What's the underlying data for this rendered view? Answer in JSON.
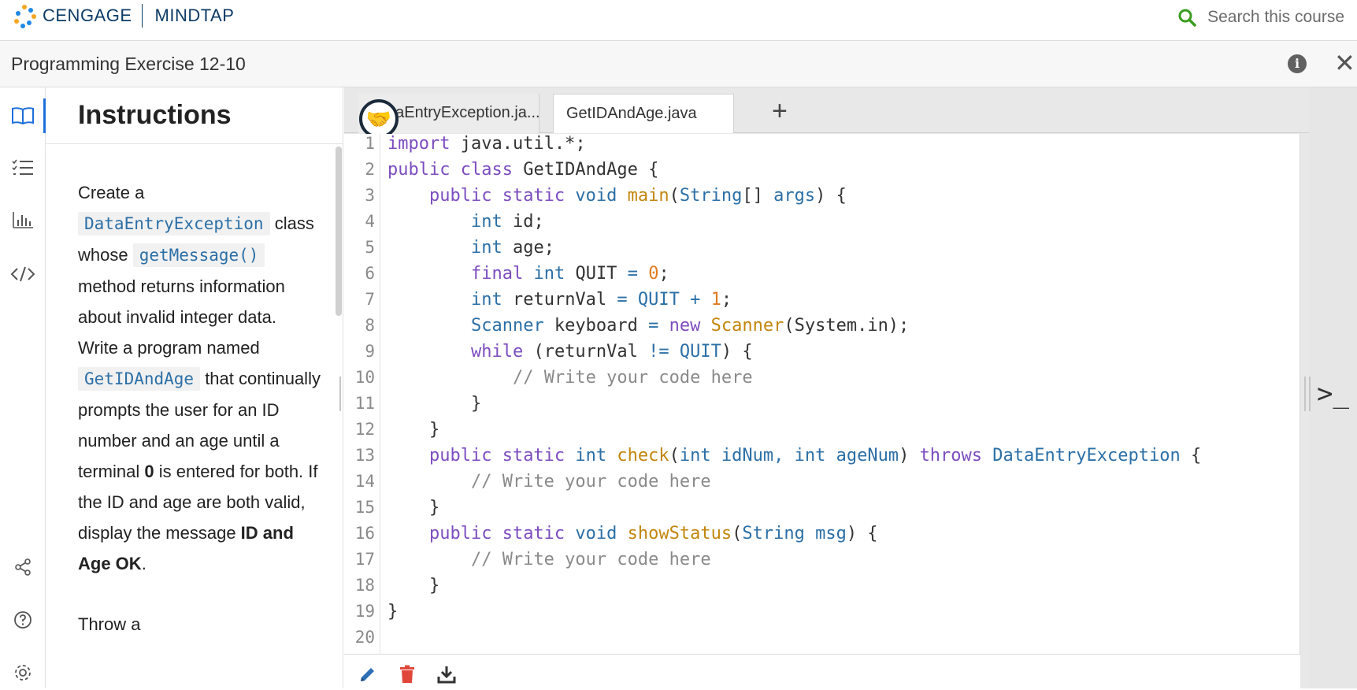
{
  "header": {
    "brand": "CENGAGE",
    "product": "MINDTAP",
    "search_placeholder": "Search this course"
  },
  "titlebar": {
    "title": "Programming Exercise 12-10"
  },
  "rail": {
    "icons": [
      "book-icon",
      "checklist-icon",
      "chart-icon",
      "code-icon",
      "share-icon",
      "help-icon",
      "settings-icon"
    ]
  },
  "instructions": {
    "title": "Instructions",
    "p1": {
      "t1": "Create a ",
      "c1": "DataEntryException",
      "t2": " class whose ",
      "c2": "getMessage()",
      "t3": " method returns information about invalid integer data. Write a program named ",
      "c3": "GetIDAndAge",
      "t4": " that continually prompts the user for an ID number and an age until a terminal ",
      "b1": "0",
      "t5": " is entered for both. If the ID and age are both valid, display the message ",
      "b2": "ID and Age OK",
      "t6": "."
    },
    "p2": "Throw a"
  },
  "editor": {
    "tabs": [
      {
        "label": "DataEntryException.ja..."
      },
      {
        "label": "GetIDAndAge.java"
      }
    ],
    "add_tab_label": "+",
    "collab_icon": "handshake-icon",
    "line_numbers": [
      "1",
      "2",
      "3",
      "4",
      "5",
      "6",
      "7",
      "8",
      "9",
      "10",
      "11",
      "12",
      "13",
      "14",
      "15",
      "16",
      "17",
      "18",
      "19",
      "20"
    ],
    "colors": {
      "keyword": "#7c4dbf",
      "type": "#2c6fa6",
      "method": "#c2860c",
      "number": "#e07b20",
      "comment": "#8a8a8a",
      "plain": "#333333"
    },
    "lines": [
      [
        [
          "k",
          "import"
        ],
        [
          "p",
          " java.util.*;"
        ]
      ],
      [
        [
          "k",
          "public class"
        ],
        [
          "p",
          " GetIDAndAge {"
        ]
      ],
      [
        [
          "p",
          "    "
        ],
        [
          "k",
          "public static"
        ],
        [
          "p",
          " "
        ],
        [
          "t",
          "void"
        ],
        [
          "p",
          " "
        ],
        [
          "m",
          "main"
        ],
        [
          "p",
          "("
        ],
        [
          "t",
          "String"
        ],
        [
          "p",
          "[] "
        ],
        [
          "t",
          "args"
        ],
        [
          "p",
          ") {"
        ]
      ],
      [
        [
          "p",
          "        "
        ],
        [
          "t",
          "int"
        ],
        [
          "p",
          " id;"
        ]
      ],
      [
        [
          "p",
          "        "
        ],
        [
          "t",
          "int"
        ],
        [
          "p",
          " age;"
        ]
      ],
      [
        [
          "p",
          "        "
        ],
        [
          "k",
          "final"
        ],
        [
          "p",
          " "
        ],
        [
          "t",
          "int"
        ],
        [
          "p",
          " QUIT "
        ],
        [
          "t",
          "="
        ],
        [
          "p",
          " "
        ],
        [
          "n",
          "0"
        ],
        [
          "p",
          ";"
        ]
      ],
      [
        [
          "p",
          "        "
        ],
        [
          "t",
          "int"
        ],
        [
          "p",
          " returnVal "
        ],
        [
          "t",
          "="
        ],
        [
          "p",
          " "
        ],
        [
          "t",
          "QUIT"
        ],
        [
          "p",
          " "
        ],
        [
          "t",
          "+"
        ],
        [
          "p",
          " "
        ],
        [
          "n",
          "1"
        ],
        [
          "p",
          ";"
        ]
      ],
      [
        [
          "p",
          "        "
        ],
        [
          "t",
          "Scanner"
        ],
        [
          "p",
          " keyboard "
        ],
        [
          "t",
          "="
        ],
        [
          "p",
          " "
        ],
        [
          "k",
          "new"
        ],
        [
          "p",
          " "
        ],
        [
          "m",
          "Scanner"
        ],
        [
          "p",
          "(System.in);"
        ]
      ],
      [
        [
          "p",
          "        "
        ],
        [
          "k",
          "while"
        ],
        [
          "p",
          " (returnVal "
        ],
        [
          "t",
          "!="
        ],
        [
          "p",
          " "
        ],
        [
          "t",
          "QUIT"
        ],
        [
          "p",
          ") {"
        ]
      ],
      [
        [
          "p",
          "            "
        ],
        [
          "c",
          "// Write your code here"
        ]
      ],
      [
        [
          "p",
          "        }"
        ]
      ],
      [
        [
          "p",
          "    }"
        ]
      ],
      [
        [
          "p",
          "    "
        ],
        [
          "k",
          "public static"
        ],
        [
          "p",
          " "
        ],
        [
          "t",
          "int"
        ],
        [
          "p",
          " "
        ],
        [
          "m",
          "check"
        ],
        [
          "p",
          "("
        ],
        [
          "t",
          "int idNum, int ageNum"
        ],
        [
          "p",
          ") "
        ],
        [
          "k",
          "throws"
        ],
        [
          "p",
          " "
        ],
        [
          "t",
          "DataEntryException"
        ],
        [
          "p",
          " {"
        ]
      ],
      [
        [
          "p",
          "        "
        ],
        [
          "c",
          "// Write your code here"
        ]
      ],
      [
        [
          "p",
          "    }"
        ]
      ],
      [
        [
          "p",
          "    "
        ],
        [
          "k",
          "public static"
        ],
        [
          "p",
          " "
        ],
        [
          "t",
          "void"
        ],
        [
          "p",
          " "
        ],
        [
          "m",
          "showStatus"
        ],
        [
          "p",
          "("
        ],
        [
          "t",
          "String msg"
        ],
        [
          "p",
          ") {"
        ]
      ],
      [
        [
          "p",
          "        "
        ],
        [
          "c",
          "// Write your code here"
        ]
      ],
      [
        [
          "p",
          "    }"
        ]
      ],
      [
        [
          "p",
          "}"
        ]
      ],
      [
        [
          "p",
          ""
        ]
      ]
    ]
  },
  "toolbar": {
    "edit_icon": "pencil-icon",
    "delete_icon": "trash-icon",
    "download_icon": "download-icon"
  },
  "console": {
    "icon_label": ">_"
  }
}
